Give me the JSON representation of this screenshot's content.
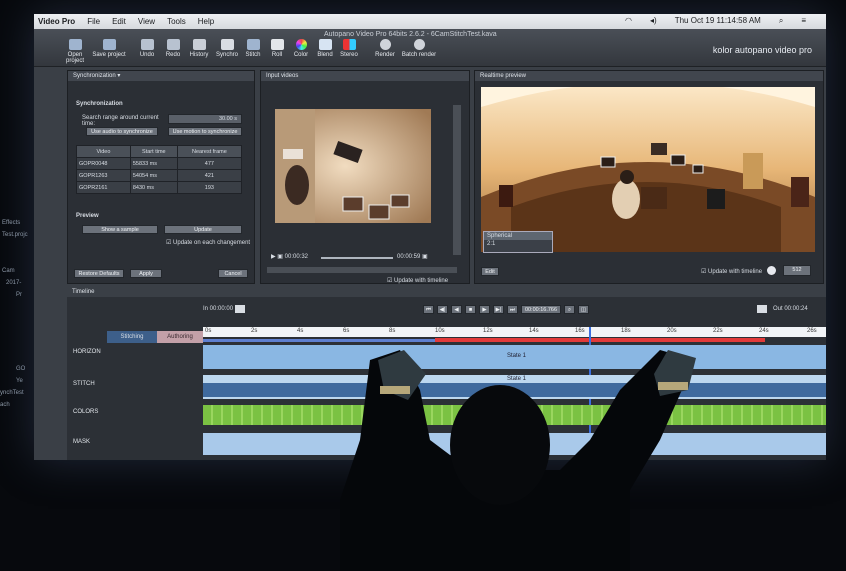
{
  "menubar": {
    "app": "Video Pro",
    "items": [
      "File",
      "Edit",
      "View",
      "Tools",
      "Help"
    ],
    "clock": "Thu Oct 19  11:14:58 AM"
  },
  "window_title": "Autopano Video Pro 64bits 2.6.2 - 6CamStitchTest.kava",
  "toolbar": {
    "buttons": [
      "Open project",
      "Save project",
      "Undo",
      "Redo",
      "History",
      "Synchro",
      "Stitch",
      "Roll",
      "Color",
      "Blend",
      "Stereo",
      "Render",
      "Batch render"
    ],
    "brand": "kolor autopano video pro"
  },
  "sync_panel": {
    "title": "Synchronization",
    "section": "Synchronization",
    "search_label": "Search range around current time:",
    "search_value": "30.00 s",
    "audio_button": "Use audio to synchronize",
    "motion_button": "Use motion to synchronize",
    "columns": [
      "Video",
      "Start time",
      "Nearest frame"
    ],
    "rows": [
      {
        "video": "GOPR0048",
        "start": "55833 ms",
        "frame": "477"
      },
      {
        "video": "GOPR1263",
        "start": "54054 ms",
        "frame": "421"
      },
      {
        "video": "GOPR2161",
        "start": "8430 ms",
        "frame": "193"
      }
    ],
    "preview_label": "Preview",
    "show_sample": "Show a sample",
    "update": "Update",
    "update_on_change": "Update on each changement",
    "restore": "Restore Defaults",
    "apply": "Apply",
    "cancel": "Cancel"
  },
  "input_panel": {
    "title": "Input videos",
    "time_current": "00:00:32",
    "time_end": "00:00:59",
    "update_with_timeline": "Update with timeline"
  },
  "realtime_panel": {
    "title": "Realtime preview",
    "projection_options": [
      "Spherical",
      "2:1"
    ],
    "edit": "Edit",
    "update_with_timeline": "Update with timeline",
    "resolution": "512"
  },
  "timeline": {
    "title": "Timeline",
    "in": "In  00:00:00",
    "out": "Out  00:00:24",
    "current_time": "00:00:16.766",
    "tabs": [
      "Stitching",
      "Authoring"
    ],
    "ticks": [
      "0s",
      "2s",
      "4s",
      "6s",
      "8s",
      "10s",
      "12s",
      "14s",
      "16s",
      "18s",
      "20s",
      "22s",
      "24s",
      "26s"
    ],
    "tracks": [
      "HORIZON",
      "STITCH",
      "COLORS",
      "MASK"
    ],
    "state_labels": [
      "State 1",
      "State 1"
    ]
  },
  "sidebar_fragments": [
    "Effects",
    "Test.projc",
    "Cam",
    "2017-",
    "Pr",
    "GO",
    "Ye",
    "ynchTest",
    "ach"
  ]
}
